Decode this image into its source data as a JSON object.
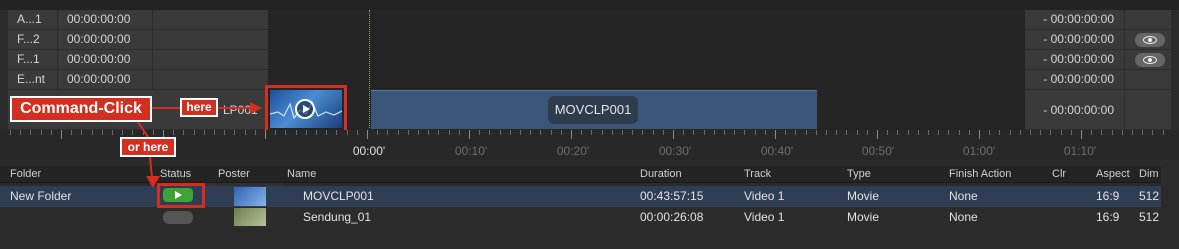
{
  "tracks": [
    {
      "name": "A...1",
      "timecode": "00:00:00:00",
      "out_timecode": "- 00:00:00:00",
      "eye_visible": false
    },
    {
      "name": "F...2",
      "timecode": "00:00:00:00",
      "out_timecode": "- 00:00:00:00",
      "eye_visible": true
    },
    {
      "name": "F...1",
      "timecode": "00:00:00:00",
      "out_timecode": "- 00:00:00:00",
      "eye_visible": true
    },
    {
      "name": "E...nt",
      "timecode": "00:00:00:00",
      "out_timecode": "- 00:00:00:00",
      "eye_visible": false
    }
  ],
  "clip_track": {
    "name_partial": "LP001",
    "out_timecode": "- 00:00:00:00"
  },
  "timeline_clip": {
    "label": "MOVCLP001"
  },
  "ruler": {
    "labels": [
      "00:00'",
      "00:10'",
      "00:20'",
      "00:30'",
      "00:40'",
      "00:50'",
      "01:00'",
      "01:10'"
    ],
    "current": "00:00'"
  },
  "annotations": {
    "command_click": "Command-Click",
    "here": "here",
    "or_here": "or here",
    "color": "#d22f20"
  },
  "table": {
    "columns": [
      "Folder",
      "Status",
      "Poster",
      "Name",
      "Duration",
      "Track",
      "Type",
      "Finish Action",
      "Clr",
      "Aspect",
      "Dim"
    ],
    "rows": [
      {
        "folder": "New Folder",
        "name": "MOVCLP001",
        "duration": "00:43:57:15",
        "track": "Video 1",
        "type": "Movie",
        "finish_action": "None",
        "aspect": "16:9",
        "dim": "512",
        "status": "playing"
      },
      {
        "folder": "",
        "name": "Sendung_01",
        "duration": "00:00:26:08",
        "track": "Video 1",
        "type": "Movie",
        "finish_action": "None",
        "aspect": "16:9",
        "dim": "512",
        "status": "idle"
      }
    ]
  },
  "colors": {
    "selected_row": "#2f3d55",
    "status_active": "#3ea332",
    "clip_bar": "#3b5679"
  }
}
